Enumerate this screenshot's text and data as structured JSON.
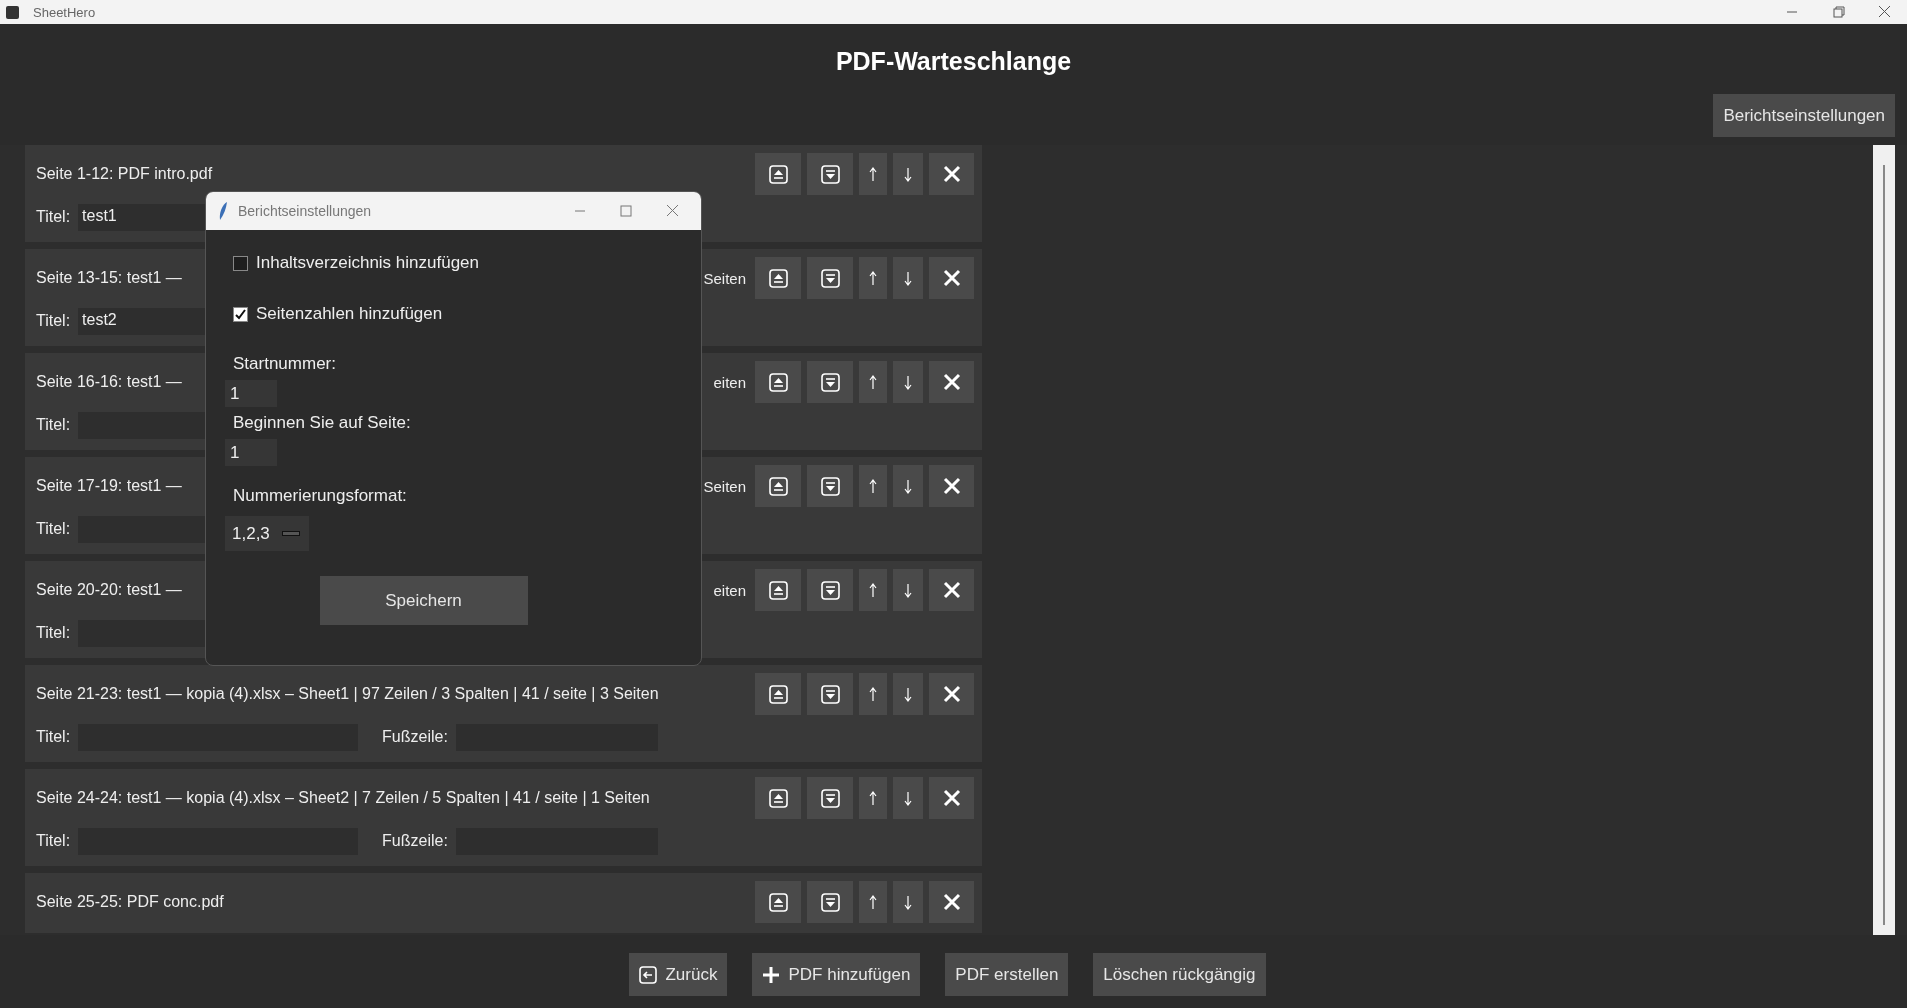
{
  "window": {
    "title": "SheetHero"
  },
  "heading": "PDF-Warteschlange",
  "settings_button": "Berichtseinstellungen",
  "queue": [
    {
      "label": "Seite 1-12: PDF intro.pdf",
      "fields": [
        {
          "label": "Titel:",
          "value": "test1"
        }
      ]
    },
    {
      "label": "Seite 13-15: test1 —",
      "label_tail": "Seiten",
      "fields": [
        {
          "label": "Titel:",
          "value": "test2"
        }
      ]
    },
    {
      "label": "Seite 16-16: test1 —",
      "label_tail": "eiten",
      "fields": [
        {
          "label": "Titel:"
        }
      ]
    },
    {
      "label": "Seite 17-19: test1 —",
      "label_tail": "Seiten",
      "fields": [
        {
          "label": "Titel:"
        }
      ]
    },
    {
      "label": "Seite 20-20: test1 —",
      "label_tail": "eiten",
      "fields": [
        {
          "label": "Titel:"
        }
      ]
    },
    {
      "label": "Seite 21-23: test1 — kopia (4).xlsx – Sheet1 | 97 Zeilen / 3 Spalten | 41 / seite | 3 Seiten",
      "fields": [
        {
          "label": "Titel:"
        },
        {
          "label": "Fußzeile:"
        }
      ]
    },
    {
      "label": "Seite 24-24: test1 — kopia (4).xlsx – Sheet2 | 7 Zeilen / 5 Spalten | 41 / seite | 1 Seiten",
      "fields": [
        {
          "label": "Titel:"
        },
        {
          "label": "Fußzeile:"
        }
      ]
    },
    {
      "label": "Seite 25-25: PDF conc.pdf"
    }
  ],
  "dialog": {
    "title": "Berichtseinstellungen",
    "options": [
      {
        "label": "Inhaltsverzeichnis hinzufügen",
        "checked": false
      },
      {
        "label": "Seitenzahlen hinzufügen",
        "checked": true
      }
    ],
    "start_number": {
      "label": "Startnummer:",
      "value": "1"
    },
    "start_page": {
      "label": "Beginnen Sie auf Seite:",
      "value": "1"
    },
    "format": {
      "label": "Nummerierungsformat:",
      "value": "1,2,3"
    },
    "save_button": "Speichern"
  },
  "footer_buttons": [
    {
      "label": "Zurück",
      "kind": "back"
    },
    {
      "label": "PDF hinzufügen",
      "kind": "add"
    },
    {
      "label": "PDF erstellen",
      "kind": "plain"
    },
    {
      "label": "Löschen rückgängig",
      "kind": "plain"
    }
  ]
}
